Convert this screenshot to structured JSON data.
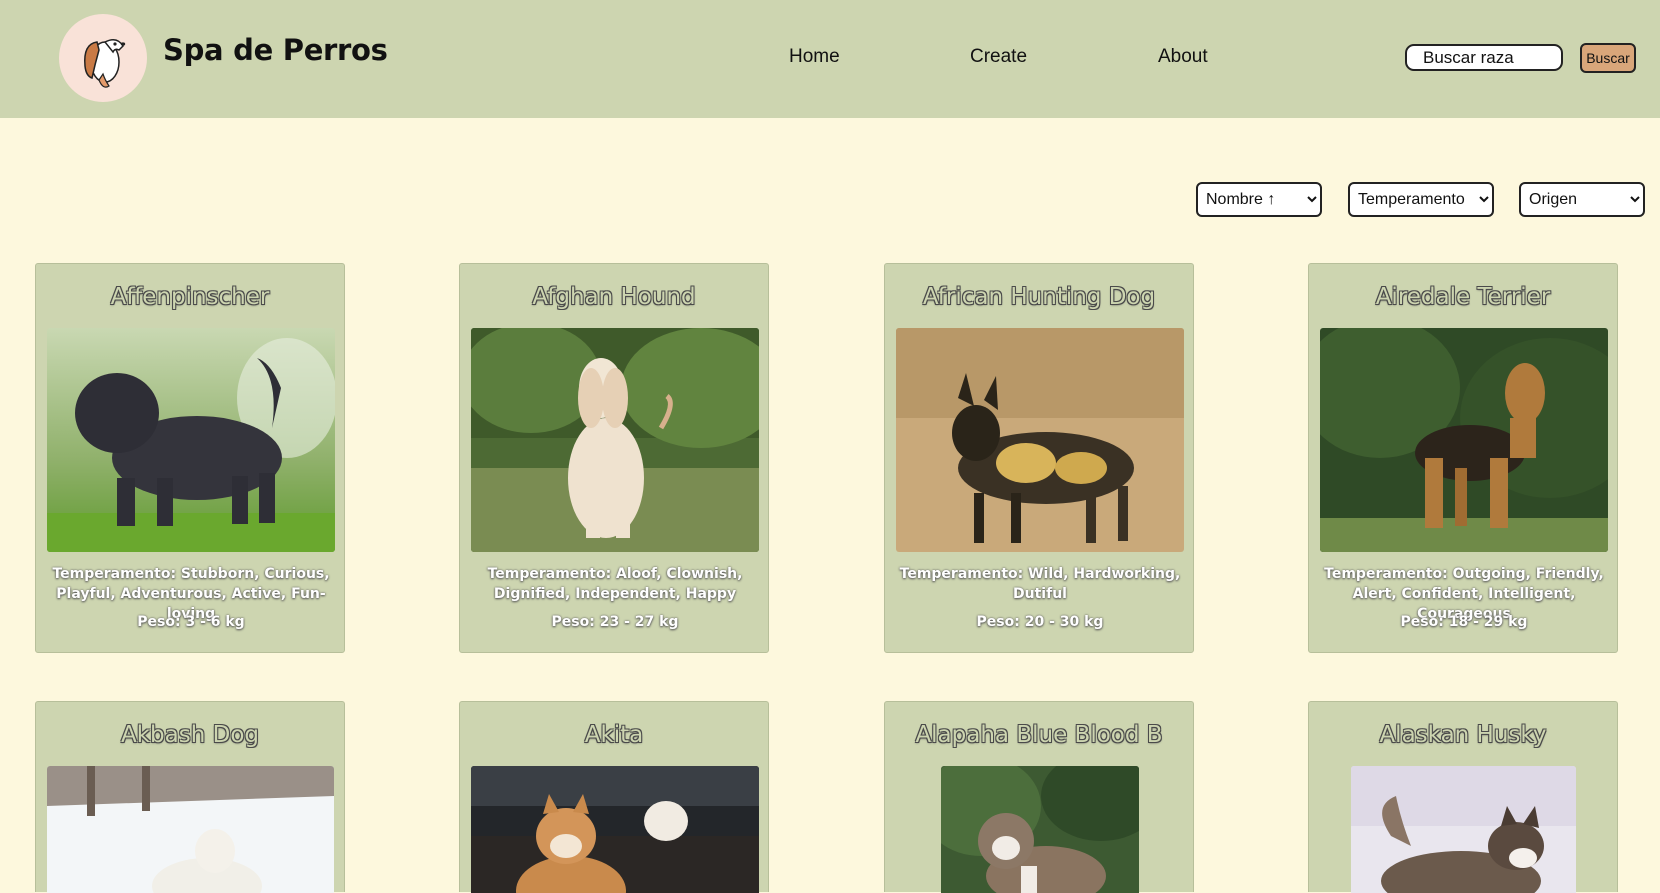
{
  "header": {
    "brand": "Spa de Perros",
    "nav": [
      "Home",
      "Create",
      "About"
    ],
    "search": {
      "placeholder": "Buscar raza",
      "button": "Buscar"
    }
  },
  "filters": {
    "sort": {
      "selected": "Nombre ↑"
    },
    "temperament": {
      "selected": "Temperamento"
    },
    "origin": {
      "selected": "Origen"
    }
  },
  "cards": [
    {
      "name": "Affenpinscher",
      "temperament": "Temperamento: Stubborn, Curious, Playful, Adventurous, Active, Fun-loving",
      "weight": "Peso: 3 - 6 kg"
    },
    {
      "name": "Afghan Hound",
      "temperament": "Temperamento: Aloof, Clownish, Dignified, Independent, Happy",
      "weight": "Peso: 23 - 27 kg"
    },
    {
      "name": "African Hunting Dog",
      "temperament": "Temperamento: Wild, Hardworking, Dutiful",
      "weight": "Peso: 20 - 30 kg"
    },
    {
      "name": "Airedale Terrier",
      "temperament": "Temperamento: Outgoing, Friendly, Alert, Confident, Intelligent, Courageous",
      "weight": "Peso: 18 - 29 kg"
    },
    {
      "name": "Akbash Dog"
    },
    {
      "name": "Akita"
    },
    {
      "name": "Alapaha Blue Blood B"
    },
    {
      "name": "Alaskan Husky"
    }
  ]
}
